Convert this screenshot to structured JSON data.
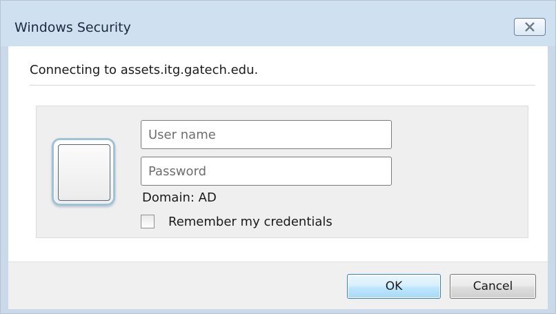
{
  "window": {
    "title": "Windows Security",
    "close_icon": "close-icon"
  },
  "message": "Connecting to assets.itg.gatech.edu.",
  "credentials": {
    "user_icon": "user-tile-icon",
    "username_placeholder": "User name",
    "username_value": "",
    "password_placeholder": "Password",
    "password_value": "",
    "domain": "Domain: AD",
    "remember_label": "Remember my credentials",
    "remember_checked": false
  },
  "buttons": {
    "ok_label": "OK",
    "cancel_label": "Cancel"
  },
  "colors": {
    "titlebar": "#cfe0f1",
    "ok_border": "#3c7fb1",
    "ok_fill": "#bee6fd",
    "tile_background": "#efefef"
  }
}
